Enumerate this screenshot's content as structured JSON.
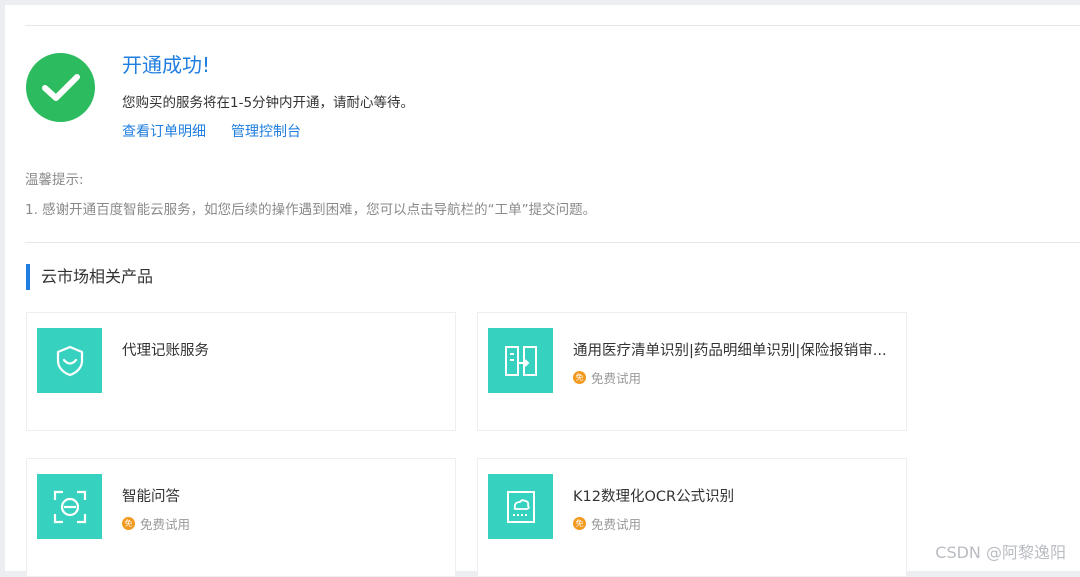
{
  "success": {
    "icon": "check-circle-icon",
    "title": "开通成功!",
    "description": "您购买的服务将在1-5分钟内开通，请耐心等待。",
    "links": [
      "查看订单明细",
      "管理控制台"
    ]
  },
  "tips": {
    "title": "温馨提示:",
    "items": [
      "1. 感谢开通百度智能云服务，如您后续的操作遇到困难，您可以点击导航栏的“工单”提交问题。"
    ]
  },
  "market": {
    "title": "云市场相关产品",
    "products": [
      {
        "name": "代理记账服务",
        "icon": "shield-smile-icon",
        "trial_label": ""
      },
      {
        "name": "通用医疗清单识别|药品明细单识别|保险报销审...",
        "icon": "document-scan-icon",
        "trial_label": "免费试用"
      },
      {
        "name": "智能问答",
        "icon": "face-scan-icon",
        "trial_label": "免费试用"
      },
      {
        "name": "K12数理化OCR公式识别",
        "icon": "cloud-scan-icon",
        "trial_label": "免费试用"
      }
    ],
    "trial_badge_text": "免"
  },
  "watermark": "CSDN @阿黎逸阳",
  "colors": {
    "accent": "#1f7ee0",
    "success": "#2cbb5f",
    "tile": "#37d2bf",
    "trial_badge": "#f29a1f"
  }
}
